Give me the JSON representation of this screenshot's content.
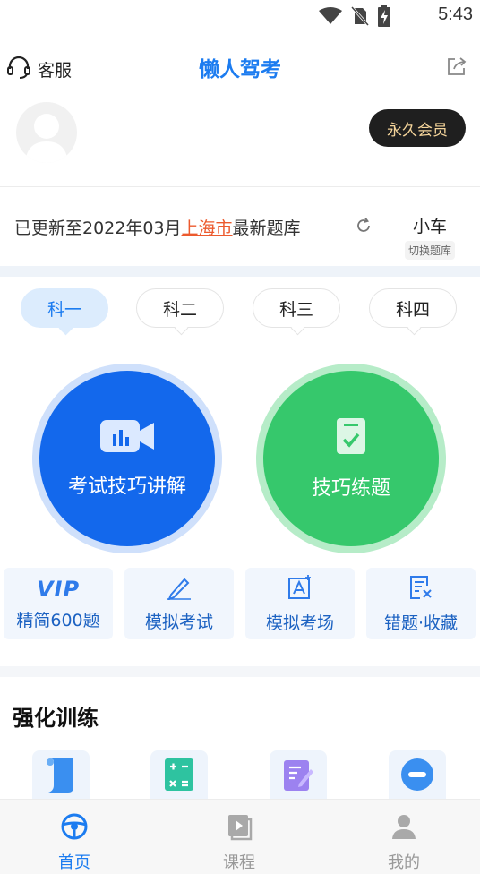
{
  "status": {
    "time": "5:43",
    "icons": [
      "wifi-icon",
      "no-sim-icon",
      "battery-charging-icon"
    ]
  },
  "header": {
    "title": "懒人驾考",
    "customer_service": "客服",
    "share_icon": "share-icon"
  },
  "profile": {
    "vip_label": "永久会员"
  },
  "update": {
    "prefix": "已更新至2022年03月",
    "city": "上海市",
    "suffix": "最新题库",
    "car_type": "小车",
    "switch_label": "切换题库"
  },
  "subjects": [
    {
      "label": "科一",
      "active": true
    },
    {
      "label": "科二",
      "active": false
    },
    {
      "label": "科三",
      "active": false
    },
    {
      "label": "科四",
      "active": false
    }
  ],
  "main_actions": {
    "exam_tips": "考试技巧讲解",
    "tips_practice": "技巧练题"
  },
  "quick": [
    {
      "label": "精简600题",
      "mark": "VIP",
      "icon": "vip-icon"
    },
    {
      "label": "模拟考试",
      "icon": "pencil-icon"
    },
    {
      "label": "模拟考场",
      "icon": "exam-paper-icon"
    },
    {
      "label": "错题·收藏",
      "icon": "wrong-answers-icon"
    }
  ],
  "training": {
    "title": "强化训练",
    "icons": [
      "scroll-icon",
      "calculator-icon",
      "edit-note-icon",
      "minus-circle-icon"
    ]
  },
  "nav": [
    {
      "label": "首页",
      "icon": "steering-wheel-icon",
      "active": true
    },
    {
      "label": "课程",
      "icon": "course-video-icon",
      "active": false
    },
    {
      "label": "我的",
      "icon": "user-icon",
      "active": false
    }
  ],
  "colors": {
    "brand": "#1c7cf0",
    "blue_circle": "#1368ec",
    "green_circle": "#36c86c",
    "vip_text": "#f4d49a",
    "city": "#ec5a2e"
  }
}
